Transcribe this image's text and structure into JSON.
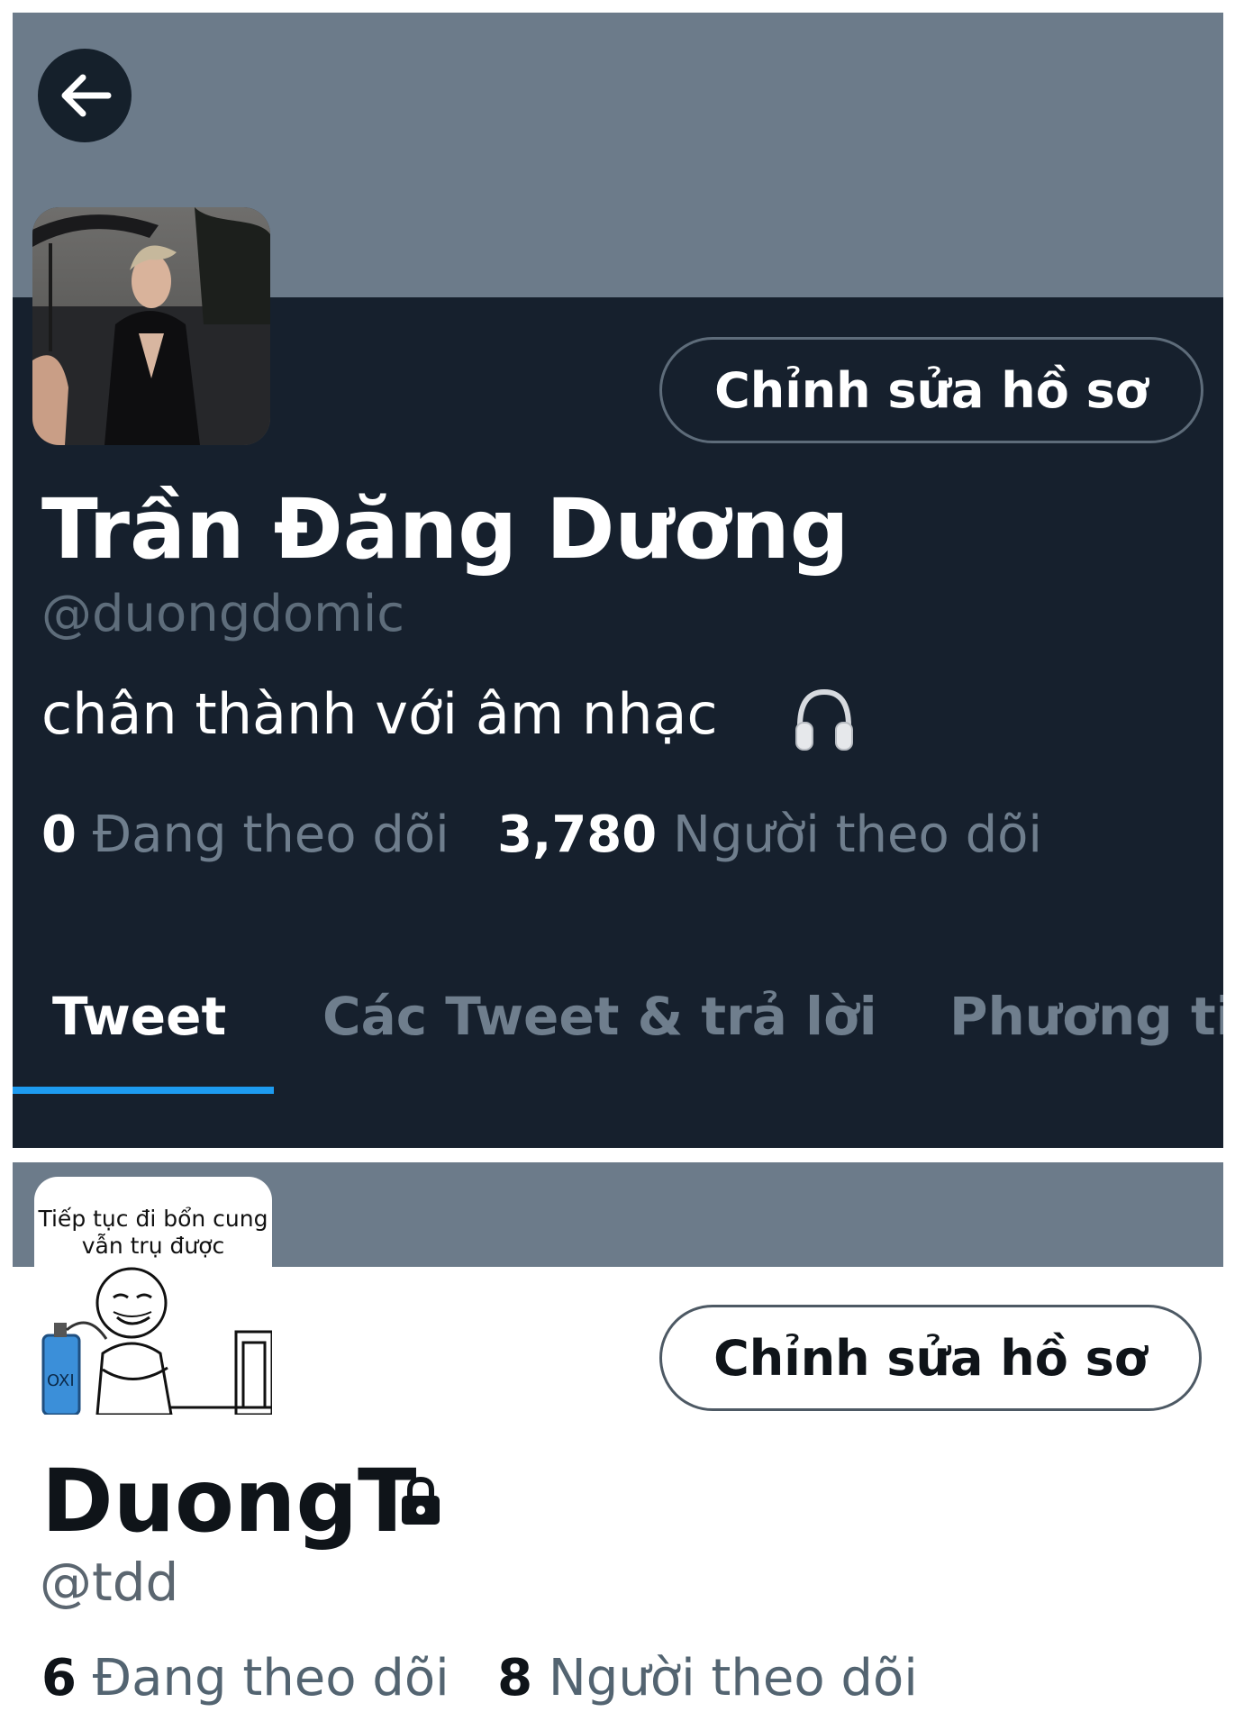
{
  "colors": {
    "banner": "#6c7b8a",
    "dark_bg": "#16202d",
    "accent_blue": "#1d9bf0",
    "muted_dark": "#6f7e8d",
    "muted_light": "#536471"
  },
  "dark_profile": {
    "back_icon": "arrow-left-icon",
    "edit_button": "Chỉnh sửa hồ sơ",
    "name": "Trần Đăng Dương",
    "handle": "@duongdomic",
    "bio": "chân thành với âm nhạc",
    "bio_icon": "headphones-icon",
    "following_count": "0",
    "following_label": "Đang theo dõi",
    "followers_count": "3,780",
    "followers_label": "Người theo dõi",
    "tabs": [
      {
        "label": "Tweet",
        "active": true
      },
      {
        "label": "Các Tweet & trả lời",
        "active": false
      },
      {
        "label": "Phương ti",
        "active": false
      }
    ]
  },
  "light_profile": {
    "avatar_caption_line1": "Tiếp tục đi bổn cung",
    "avatar_caption_line2": "vẫn trụ được",
    "avatar_tank_label": "OXI",
    "edit_button": "Chỉnh sửa hồ sơ",
    "name": "DuongT",
    "name_icon": "lock-icon",
    "handle": "@tdd",
    "following_count": "6",
    "following_label": "Đang theo dõi",
    "followers_count": "8",
    "followers_label": "Người theo dõi"
  }
}
